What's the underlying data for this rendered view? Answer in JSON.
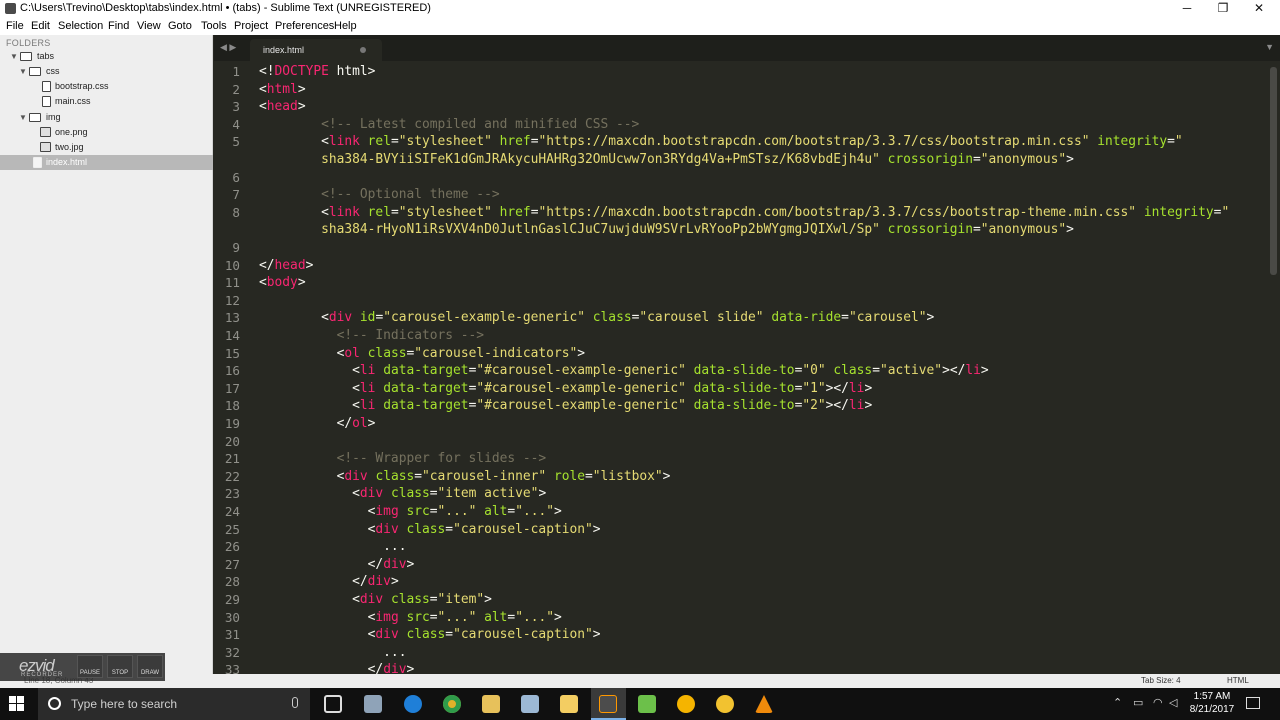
{
  "window": {
    "title": "C:\\Users\\Trevino\\Desktop\\tabs\\index.html • (tabs) - Sublime Text (UNREGISTERED)",
    "controls": {
      "minimize": "─",
      "maximize": "❐",
      "close": "✕"
    }
  },
  "menu": [
    "File",
    "Edit",
    "Selection",
    "Find",
    "View",
    "Goto",
    "Tools",
    "Project",
    "Preferences",
    "Help"
  ],
  "sidebar": {
    "header": "FOLDERS",
    "tree": [
      {
        "label": "tabs",
        "kind": "folder",
        "open": true
      },
      {
        "label": "css",
        "kind": "folder",
        "open": true
      },
      {
        "label": "bootstrap.css",
        "kind": "file"
      },
      {
        "label": "main.css",
        "kind": "file"
      },
      {
        "label": "img",
        "kind": "folder",
        "open": true
      },
      {
        "label": "one.png",
        "kind": "image"
      },
      {
        "label": "two.jpg",
        "kind": "image"
      },
      {
        "label": "index.html",
        "kind": "file",
        "selected": true
      }
    ]
  },
  "tabbar": {
    "nav_arrows": "◀ ▶",
    "tab_label": "index.html",
    "dropdown": "▼"
  },
  "editor": {
    "line_numbers": [
      "1",
      "2",
      "3",
      "4",
      "5",
      "",
      "6",
      "7",
      "8",
      "",
      "9",
      "10",
      "11",
      "12",
      "13",
      "14",
      "15",
      "16",
      "17",
      "18",
      "19",
      "20",
      "21",
      "22",
      "23",
      "24",
      "25",
      "26",
      "27",
      "28",
      "29",
      "30",
      "31",
      "32",
      "33"
    ],
    "lines": [
      [
        [
          "pu",
          "<!"
        ],
        [
          "dt",
          "DOCTYPE"
        ],
        [
          "pu",
          " html>"
        ]
      ],
      [
        [
          "pu",
          "<"
        ],
        [
          "tg",
          "html"
        ],
        [
          "pu",
          ">"
        ]
      ],
      [
        [
          "pu",
          "<"
        ],
        [
          "tg",
          "head"
        ],
        [
          "pu",
          ">"
        ]
      ],
      [
        [
          "pu",
          "        "
        ],
        [
          "cm",
          "<!-- Latest compiled and minified CSS -->"
        ]
      ],
      [
        [
          "pu",
          "        <"
        ],
        [
          "tg",
          "link"
        ],
        [
          "pu",
          " "
        ],
        [
          "at",
          "rel"
        ],
        [
          "pu",
          "="
        ],
        [
          "st",
          "\"stylesheet\""
        ],
        [
          "pu",
          " "
        ],
        [
          "at",
          "href"
        ],
        [
          "pu",
          "="
        ],
        [
          "st",
          "\"https://maxcdn.bootstrapcdn.com/bootstrap/3.3.7/css/bootstrap.min.css\""
        ],
        [
          "pu",
          " "
        ],
        [
          "at",
          "integrity"
        ],
        [
          "pu",
          "="
        ],
        [
          "st",
          "\""
        ]
      ],
      [
        [
          "st",
          "        sha384-BVYiiSIFeK1dGmJRAkycuHAHRg32OmUcww7on3RYdg4Va+PmSTsz/K68vbdEjh4u\""
        ],
        [
          "pu",
          " "
        ],
        [
          "at",
          "crossorigin"
        ],
        [
          "pu",
          "="
        ],
        [
          "st",
          "\"anonymous\""
        ],
        [
          "pu",
          ">"
        ]
      ],
      [],
      [
        [
          "pu",
          "        "
        ],
        [
          "cm",
          "<!-- Optional theme -->"
        ]
      ],
      [
        [
          "pu",
          "        <"
        ],
        [
          "tg",
          "link"
        ],
        [
          "pu",
          " "
        ],
        [
          "at",
          "rel"
        ],
        [
          "pu",
          "="
        ],
        [
          "st",
          "\"stylesheet\""
        ],
        [
          "pu",
          " "
        ],
        [
          "at",
          "href"
        ],
        [
          "pu",
          "="
        ],
        [
          "st",
          "\"https://maxcdn.bootstrapcdn.com/bootstrap/3.3.7/css/bootstrap-theme.min.css\""
        ],
        [
          "pu",
          " "
        ],
        [
          "at",
          "integrity"
        ],
        [
          "pu",
          "="
        ],
        [
          "st",
          "\""
        ]
      ],
      [
        [
          "st",
          "        sha384-rHyoN1iRsVXV4nD0JutlnGaslCJuC7uwjduW9SVrLvRYooPp2bWYgmgJQIXwl/Sp\""
        ],
        [
          "pu",
          " "
        ],
        [
          "at",
          "crossorigin"
        ],
        [
          "pu",
          "="
        ],
        [
          "st",
          "\"anonymous\""
        ],
        [
          "pu",
          ">"
        ]
      ],
      [],
      [
        [
          "pu",
          "</"
        ],
        [
          "tg",
          "head"
        ],
        [
          "pu",
          ">"
        ]
      ],
      [
        [
          "pu",
          "<"
        ],
        [
          "tg",
          "body"
        ],
        [
          "pu",
          ">"
        ]
      ],
      [],
      [
        [
          "pu",
          "        <"
        ],
        [
          "tg",
          "div"
        ],
        [
          "pu",
          " "
        ],
        [
          "at",
          "id"
        ],
        [
          "pu",
          "="
        ],
        [
          "st",
          "\"carousel-example-generic\""
        ],
        [
          "pu",
          " "
        ],
        [
          "at",
          "class"
        ],
        [
          "pu",
          "="
        ],
        [
          "st",
          "\"carousel slide\""
        ],
        [
          "pu",
          " "
        ],
        [
          "at",
          "data-ride"
        ],
        [
          "pu",
          "="
        ],
        [
          "st",
          "\"carousel\""
        ],
        [
          "pu",
          ">"
        ]
      ],
      [
        [
          "pu",
          "          "
        ],
        [
          "cm",
          "<!-- Indicators -->"
        ]
      ],
      [
        [
          "pu",
          "          <"
        ],
        [
          "tg",
          "ol"
        ],
        [
          "pu",
          " "
        ],
        [
          "at",
          "class"
        ],
        [
          "pu",
          "="
        ],
        [
          "st",
          "\"carousel-indicators\""
        ],
        [
          "pu",
          ">"
        ]
      ],
      [
        [
          "pu",
          "            <"
        ],
        [
          "tg",
          "li"
        ],
        [
          "pu",
          " "
        ],
        [
          "at",
          "data-target"
        ],
        [
          "pu",
          "="
        ],
        [
          "st",
          "\"#carousel-example-generic\""
        ],
        [
          "pu",
          " "
        ],
        [
          "at",
          "data-slide-to"
        ],
        [
          "pu",
          "="
        ],
        [
          "st",
          "\"0\""
        ],
        [
          "pu",
          " "
        ],
        [
          "at",
          "class"
        ],
        [
          "pu",
          "="
        ],
        [
          "st",
          "\"active\""
        ],
        [
          "pu",
          "></"
        ],
        [
          "tg",
          "li"
        ],
        [
          "pu",
          ">"
        ]
      ],
      [
        [
          "pu",
          "            <"
        ],
        [
          "tg",
          "li"
        ],
        [
          "pu",
          " "
        ],
        [
          "at",
          "data-target"
        ],
        [
          "pu",
          "="
        ],
        [
          "st",
          "\"#carousel-example-generic\""
        ],
        [
          "pu",
          " "
        ],
        [
          "at",
          "data-slide-to"
        ],
        [
          "pu",
          "="
        ],
        [
          "st",
          "\"1\""
        ],
        [
          "pu",
          "></"
        ],
        [
          "tg",
          "li"
        ],
        [
          "pu",
          ">"
        ]
      ],
      [
        [
          "pu",
          "            <"
        ],
        [
          "tg",
          "li"
        ],
        [
          "pu",
          " "
        ],
        [
          "at",
          "data-target"
        ],
        [
          "pu",
          "="
        ],
        [
          "st",
          "\"#carousel-example-generic\""
        ],
        [
          "pu",
          " "
        ],
        [
          "at",
          "data-slide-to"
        ],
        [
          "pu",
          "="
        ],
        [
          "st",
          "\"2\""
        ],
        [
          "pu",
          "></"
        ],
        [
          "tg",
          "li"
        ],
        [
          "pu",
          ">"
        ]
      ],
      [
        [
          "pu",
          "          </"
        ],
        [
          "tg",
          "ol"
        ],
        [
          "pu",
          ">"
        ]
      ],
      [],
      [
        [
          "pu",
          "          "
        ],
        [
          "cm",
          "<!-- Wrapper for slides -->"
        ]
      ],
      [
        [
          "pu",
          "          <"
        ],
        [
          "tg",
          "div"
        ],
        [
          "pu",
          " "
        ],
        [
          "at",
          "class"
        ],
        [
          "pu",
          "="
        ],
        [
          "st",
          "\"carousel-inner\""
        ],
        [
          "pu",
          " "
        ],
        [
          "at",
          "role"
        ],
        [
          "pu",
          "="
        ],
        [
          "st",
          "\"listbox\""
        ],
        [
          "pu",
          ">"
        ]
      ],
      [
        [
          "pu",
          "            <"
        ],
        [
          "tg",
          "div"
        ],
        [
          "pu",
          " "
        ],
        [
          "at",
          "class"
        ],
        [
          "pu",
          "="
        ],
        [
          "st",
          "\"item active\""
        ],
        [
          "pu",
          ">"
        ]
      ],
      [
        [
          "pu",
          "              <"
        ],
        [
          "tg",
          "img"
        ],
        [
          "pu",
          " "
        ],
        [
          "at",
          "src"
        ],
        [
          "pu",
          "="
        ],
        [
          "st",
          "\"...\""
        ],
        [
          "pu",
          " "
        ],
        [
          "at",
          "alt"
        ],
        [
          "pu",
          "="
        ],
        [
          "st",
          "\"...\""
        ],
        [
          "pu",
          ">"
        ]
      ],
      [
        [
          "pu",
          "              <"
        ],
        [
          "tg",
          "div"
        ],
        [
          "pu",
          " "
        ],
        [
          "at",
          "class"
        ],
        [
          "pu",
          "="
        ],
        [
          "st",
          "\"carousel-caption\""
        ],
        [
          "pu",
          ">"
        ]
      ],
      [
        [
          "pu",
          "                ..."
        ]
      ],
      [
        [
          "pu",
          "              </"
        ],
        [
          "tg",
          "div"
        ],
        [
          "pu",
          ">"
        ]
      ],
      [
        [
          "pu",
          "            </"
        ],
        [
          "tg",
          "div"
        ],
        [
          "pu",
          ">"
        ]
      ],
      [
        [
          "pu",
          "            <"
        ],
        [
          "tg",
          "div"
        ],
        [
          "pu",
          " "
        ],
        [
          "at",
          "class"
        ],
        [
          "pu",
          "="
        ],
        [
          "st",
          "\"item\""
        ],
        [
          "pu",
          ">"
        ]
      ],
      [
        [
          "pu",
          "              <"
        ],
        [
          "tg",
          "img"
        ],
        [
          "pu",
          " "
        ],
        [
          "at",
          "src"
        ],
        [
          "pu",
          "="
        ],
        [
          "st",
          "\"...\""
        ],
        [
          "pu",
          " "
        ],
        [
          "at",
          "alt"
        ],
        [
          "pu",
          "="
        ],
        [
          "st",
          "\"...\""
        ],
        [
          "pu",
          ">"
        ]
      ],
      [
        [
          "pu",
          "              <"
        ],
        [
          "tg",
          "div"
        ],
        [
          "pu",
          " "
        ],
        [
          "at",
          "class"
        ],
        [
          "pu",
          "="
        ],
        [
          "st",
          "\"carousel-caption\""
        ],
        [
          "pu",
          ">"
        ]
      ],
      [
        [
          "pu",
          "                ..."
        ]
      ],
      [
        [
          "pu",
          "              </"
        ],
        [
          "tg",
          "div"
        ],
        [
          "pu",
          ">"
        ]
      ]
    ]
  },
  "statusbar": {
    "position": "Line 18, Column 43",
    "tab_size": "Tab Size: 4",
    "syntax": "HTML"
  },
  "recorder": {
    "logo": "ezvid",
    "sublabel": "RECORDER",
    "buttons": [
      "PAUSE",
      "STOP",
      "DRAW"
    ]
  },
  "taskbar": {
    "search_placeholder": "Type here to search",
    "time": "1:57 AM",
    "date": "8/21/2017"
  },
  "colors": {
    "editor_bg": "#272822",
    "tag": "#f92672",
    "attribute": "#a6e22e",
    "string": "#e6db74",
    "comment": "#75715e"
  }
}
